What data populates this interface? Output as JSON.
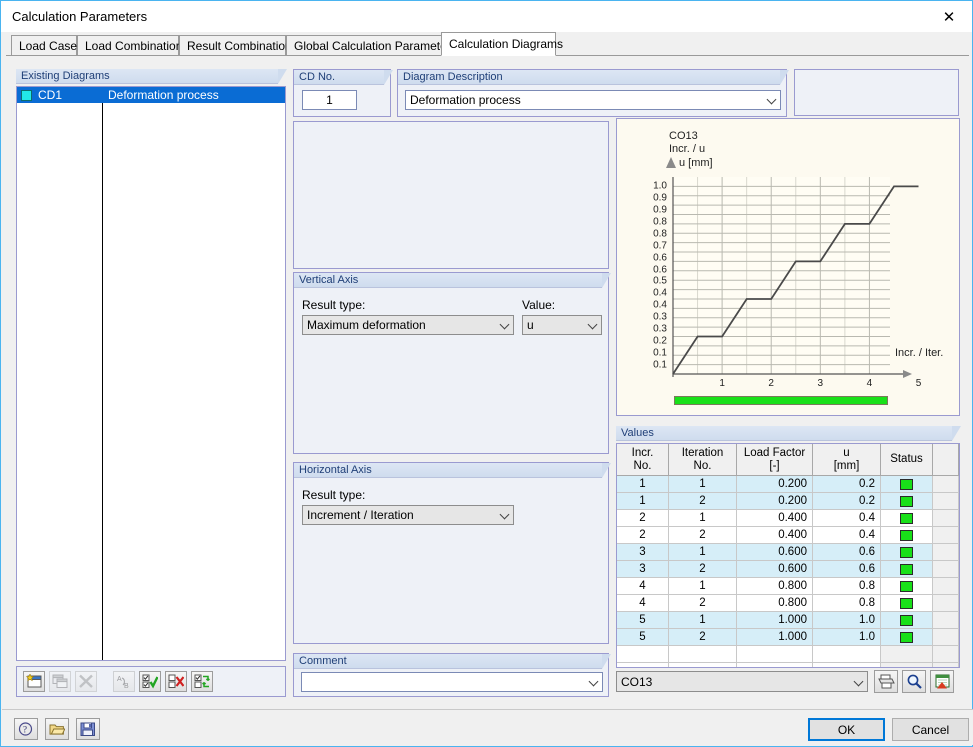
{
  "window": {
    "title": "Calculation Parameters",
    "close_icon": "close-icon"
  },
  "tabs": [
    {
      "label": "Load Cases",
      "active": false
    },
    {
      "label": "Load Combinations",
      "active": false
    },
    {
      "label": "Result Combinations",
      "active": false
    },
    {
      "label": "Global Calculation Parameters",
      "active": false
    },
    {
      "label": "Calculation Diagrams",
      "active": true
    }
  ],
  "existing_diagrams": {
    "title": "Existing Diagrams",
    "rows": [
      {
        "id": "CD1",
        "description": "Deformation process",
        "color": "#22e8e8",
        "selected": true
      }
    ]
  },
  "cd_no": {
    "title": "CD No.",
    "value": "1"
  },
  "diagram_description": {
    "title": "Diagram Description",
    "value": "Deformation process"
  },
  "vertical_axis": {
    "title": "Vertical Axis",
    "result_type_label": "Result type:",
    "result_type_value": "Maximum deformation",
    "value_label": "Value:",
    "value_value": "u"
  },
  "horizontal_axis": {
    "title": "Horizontal Axis",
    "result_type_label": "Result type:",
    "result_type_value": "Increment / Iteration"
  },
  "comment": {
    "title": "Comment",
    "value": "",
    "placeholder": ""
  },
  "list_toolbar": [
    {
      "name": "new-diagram-button",
      "icon": "new-window-icon",
      "enabled": true
    },
    {
      "name": "copy-diagram-button",
      "icon": "copy-window-icon",
      "enabled": false
    },
    {
      "name": "delete-diagram-button",
      "icon": "delete-x-icon",
      "enabled": false
    },
    {
      "name": "rename-diagram-button",
      "icon": "rename-a-b-icon",
      "enabled": false
    },
    {
      "name": "select-all-button",
      "icon": "check-all-icon",
      "enabled": true
    },
    {
      "name": "deselect-all-button",
      "icon": "uncheck-all-icon",
      "enabled": true
    },
    {
      "name": "invert-selection-button",
      "icon": "invert-selection-icon",
      "enabled": true
    }
  ],
  "chart_data": {
    "type": "line",
    "title": "CO13",
    "subtitle": "Incr. / u",
    "ylabel": "u [mm]",
    "xlabel": "Incr. / Iter.",
    "ylim": [
      0,
      1.05
    ],
    "xlim": [
      0,
      5.6
    ],
    "grid": true,
    "legend": "none",
    "yticks": [
      1.0,
      0.9,
      0.9,
      0.8,
      0.8,
      0.7,
      0.6,
      0.6,
      0.5,
      0.4,
      0.4,
      0.3,
      0.3,
      0.2,
      0.1,
      0.1
    ],
    "ytick_values": [
      1.0,
      0.95,
      0.9,
      0.85,
      0.8,
      0.75,
      0.7,
      0.65,
      0.6,
      0.55,
      0.5,
      0.45,
      0.4,
      0.35,
      0.3,
      0.25,
      0.2,
      0.15,
      0.1,
      0.05
    ],
    "ytick_labels": [
      "1.0",
      "0.9",
      "0.9",
      "0.8",
      "0.8",
      "0.7",
      "0.6",
      "0.6",
      "0.5",
      "0.4",
      "0.4",
      "0.3",
      "0.3",
      "0.2",
      "0.1",
      "0.1"
    ],
    "xticks": [
      1,
      2,
      3,
      4,
      5
    ],
    "xtick_labels": [
      "1",
      "2",
      "3",
      "4",
      "5"
    ],
    "series": [
      {
        "name": "u",
        "x": [
          0.0,
          0.5,
          1.0,
          1.5,
          2.0,
          2.5,
          3.0,
          3.5,
          4.0,
          4.5,
          5.0
        ],
        "y": [
          0.0,
          0.2,
          0.2,
          0.4,
          0.4,
          0.6,
          0.6,
          0.8,
          0.8,
          1.0,
          1.0
        ]
      }
    ],
    "progress_percent": 100
  },
  "values": {
    "title": "Values",
    "columns": [
      {
        "line1": "Incr.",
        "line2": "No."
      },
      {
        "line1": "Iteration",
        "line2": "No."
      },
      {
        "line1": "Load Factor",
        "line2": "[-]"
      },
      {
        "line1": "u",
        "line2": "[mm]"
      },
      {
        "line1": "Status",
        "line2": ""
      },
      {
        "line1": "",
        "line2": ""
      }
    ],
    "rows": [
      {
        "incr": "1",
        "iter": "1",
        "factor": "0.200",
        "u": "0.2",
        "status": "ok"
      },
      {
        "incr": "1",
        "iter": "2",
        "factor": "0.200",
        "u": "0.2",
        "status": "ok"
      },
      {
        "incr": "2",
        "iter": "1",
        "factor": "0.400",
        "u": "0.4",
        "status": "ok"
      },
      {
        "incr": "2",
        "iter": "2",
        "factor": "0.400",
        "u": "0.4",
        "status": "ok"
      },
      {
        "incr": "3",
        "iter": "1",
        "factor": "0.600",
        "u": "0.6",
        "status": "ok"
      },
      {
        "incr": "3",
        "iter": "2",
        "factor": "0.600",
        "u": "0.6",
        "status": "ok"
      },
      {
        "incr": "4",
        "iter": "1",
        "factor": "0.800",
        "u": "0.8",
        "status": "ok"
      },
      {
        "incr": "4",
        "iter": "2",
        "factor": "0.800",
        "u": "0.8",
        "status": "ok"
      },
      {
        "incr": "5",
        "iter": "1",
        "factor": "1.000",
        "u": "1.0",
        "status": "ok"
      },
      {
        "incr": "5",
        "iter": "2",
        "factor": "1.000",
        "u": "1.0",
        "status": "ok"
      }
    ],
    "status_color": "#19e019"
  },
  "result_selector": {
    "value": "CO13",
    "buttons": [
      {
        "name": "print-button",
        "icon": "printer-icon"
      },
      {
        "name": "zoom-button",
        "icon": "magnifier-icon"
      },
      {
        "name": "export-excel-button",
        "icon": "excel-export-icon"
      }
    ]
  },
  "statusbar": {
    "buttons": [
      {
        "name": "help-button",
        "icon": "help-icon"
      },
      {
        "name": "open-button",
        "icon": "folder-open-icon"
      },
      {
        "name": "save-button",
        "icon": "floppy-save-icon"
      }
    ],
    "ok_label": "OK",
    "cancel_label": "Cancel"
  }
}
